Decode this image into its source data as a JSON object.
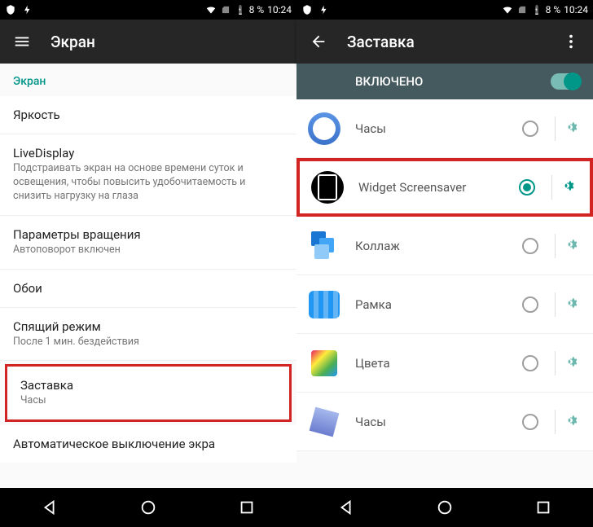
{
  "status": {
    "battery": "8 %",
    "time": "10:24"
  },
  "left": {
    "title": "Экран",
    "section": "Экран",
    "rows": [
      {
        "primary": "Яркость"
      },
      {
        "primary": "LiveDisplay",
        "secondary": "Подстраивать экран на основе времени суток и освещения, чтобы повысить удобочитаемость и снизить нагрузку на глаза"
      },
      {
        "primary": "Параметры вращения",
        "secondary": "Автоповорот включен"
      },
      {
        "primary": "Обои"
      },
      {
        "primary": "Спящий режим",
        "secondary": "После 1 мин. бездействия"
      },
      {
        "primary": "Заставка",
        "secondary": "Часы",
        "highlighted": true
      }
    ],
    "truncated": "Автоматическое выключение экра"
  },
  "right": {
    "title": "Заставка",
    "enabled_label": "ВКЛЮЧЕНО",
    "items": [
      {
        "label": "Часы",
        "icon": "clock",
        "selected": false
      },
      {
        "label": "Widget Screensaver",
        "icon": "widget",
        "selected": true,
        "highlighted": true
      },
      {
        "label": "Коллаж",
        "icon": "collage",
        "selected": false
      },
      {
        "label": "Рамка",
        "icon": "frame",
        "selected": false
      },
      {
        "label": "Цвета",
        "icon": "colors",
        "selected": false
      },
      {
        "label": "Часы",
        "icon": "cube",
        "selected": false
      }
    ]
  }
}
